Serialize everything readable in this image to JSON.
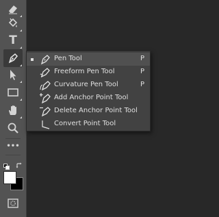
{
  "tools": [
    {
      "name": "eraser",
      "icon": "eraser-icon"
    },
    {
      "name": "paint-bucket",
      "icon": "paint-bucket-icon"
    },
    {
      "name": "type",
      "icon": "type-icon",
      "glyph": "T"
    },
    {
      "name": "pen",
      "icon": "pen-icon",
      "active": true
    },
    {
      "name": "path-selection",
      "icon": "arrow-cursor-icon"
    },
    {
      "name": "rectangle",
      "icon": "rectangle-icon"
    },
    {
      "name": "hand",
      "icon": "hand-icon"
    },
    {
      "name": "zoom",
      "icon": "magnifier-icon"
    },
    {
      "name": "more",
      "icon": "more-dots-icon",
      "glyph": "•••"
    }
  ],
  "colors": {
    "foreground": "#ffffff",
    "background": "#000000",
    "panel": "#535353",
    "flyout": "#424242",
    "selected": "#505050",
    "text": "#e0e0e0"
  },
  "flyout": {
    "items": [
      {
        "label": "Pen Tool",
        "shortcut": "P",
        "icon": "pen-icon",
        "selected": true
      },
      {
        "label": "Freeform Pen Tool",
        "shortcut": "P",
        "icon": "freeform-pen-icon"
      },
      {
        "label": "Curvature Pen Tool",
        "shortcut": "P",
        "icon": "curvature-pen-icon"
      },
      {
        "label": "Add Anchor Point Tool",
        "shortcut": "",
        "icon": "add-anchor-point-icon"
      },
      {
        "label": "Delete Anchor Point Tool",
        "shortcut": "",
        "icon": "delete-anchor-point-icon"
      },
      {
        "label": "Convert Point Tool",
        "shortcut": "",
        "icon": "convert-point-icon"
      }
    ]
  }
}
